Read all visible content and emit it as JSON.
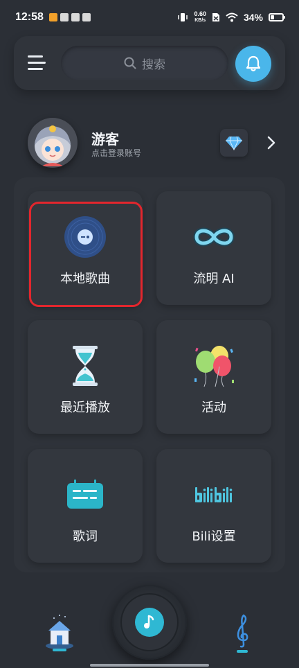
{
  "status_bar": {
    "time": "12:58",
    "net_speed_value": "0.60",
    "net_speed_unit": "KB/s",
    "battery_pct": "34%",
    "battery_level": 0.34
  },
  "top_bar": {
    "search_placeholder": "搜索",
    "accent_color": "#4ab6ea"
  },
  "profile": {
    "name": "游客",
    "subtitle": "点击登录账号"
  },
  "grid": [
    {
      "label": "本地歌曲",
      "icon": "vinyl-disc-icon"
    },
    {
      "label": "流明 AI",
      "icon": "infinity-icon"
    },
    {
      "label": "最近播放",
      "icon": "hourglass-icon"
    },
    {
      "label": "活动",
      "icon": "balloons-icon"
    },
    {
      "label": "歌词",
      "icon": "lyrics-icon"
    },
    {
      "label": "Bili设置",
      "icon": "bilibili-logo"
    }
  ],
  "highlight_color": "#e3262d",
  "bottom_nav": {
    "items": [
      "home-icon",
      "play-music-icon",
      "music-note-icon"
    ]
  }
}
